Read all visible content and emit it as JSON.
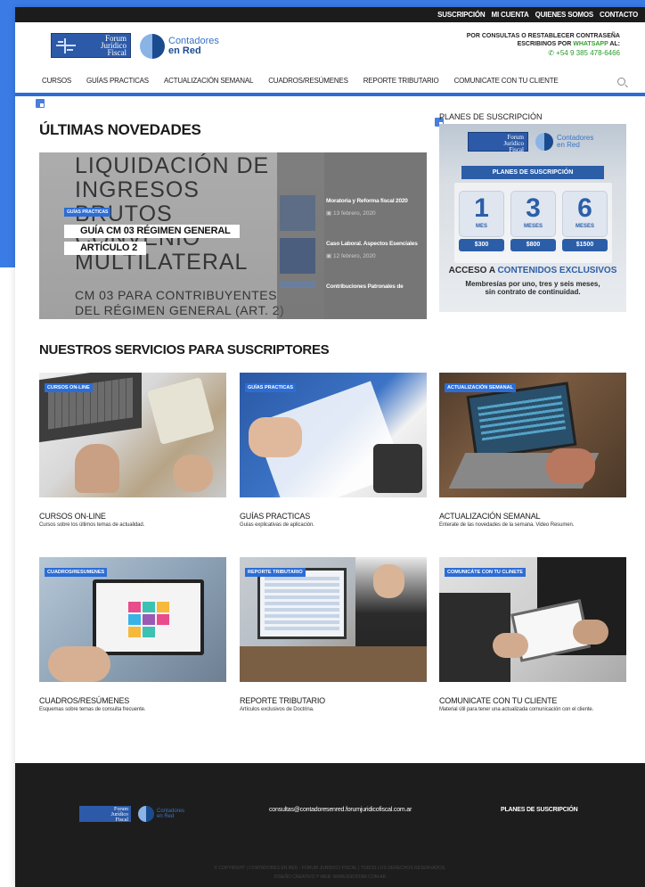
{
  "topbar": {
    "links": [
      "SUSCRIPCIÓN",
      "MI CUENTA",
      "QUIENES SOMOS",
      "CONTACTO"
    ]
  },
  "header": {
    "logo_forum": [
      "Forum",
      "Jurídico",
      "Fiscal"
    ],
    "logo_contadores": [
      "Contadores",
      "en Red"
    ],
    "contact_line1": "POR CONSULTAS O RESTABLECER CONTRASEÑA",
    "contact_line2_prefix": "ESCRIBINOS POR ",
    "contact_whatsapp": "WHATSAPP",
    "contact_line2_suffix": " AL:",
    "contact_phone": "+54 9 385 478-6466"
  },
  "nav": {
    "items": [
      "CURSOS",
      "GUÍAS PRACTICAS",
      "ACTUALIZACIÓN SEMANAL",
      "CUADROS/RESÚMENES",
      "REPORTE TRIBUTARIO",
      "COMUNICATE CON TU CLIENTE"
    ]
  },
  "latest": {
    "heading": "ÚLTIMAS NOVEDADES",
    "hero_image_text": [
      "LIQUIDACIÓN DE",
      "INGRESOS",
      "BRUTOS",
      "CONVENIO",
      "MULTILATERAL"
    ],
    "hero_image_small": [
      "CM 03 PARA CONTRIBUYENTES",
      "DEL RÉGIMEN GENERAL (ART. 2)"
    ],
    "hero_badge": "GUÍAS PRACTICAS",
    "hero_title": "GUÍA CM 03 RÉGIMEN GENERAL ARTÍCULO 2",
    "side": [
      {
        "title": "Moratoria y Reforma fiscal 2020",
        "date": "13 febrero, 2020"
      },
      {
        "title": "Caso Laboral. Aspectos Esenciales",
        "date": "12 febrero, 2020"
      },
      {
        "title": "Contribuciones Patronales de",
        "date": ""
      }
    ]
  },
  "plans": {
    "title": "PLANES DE SUSCRIPCIÓN",
    "card_header": "PLANES DE SUSCRIPCIÓN",
    "logo_forum": [
      "Forum",
      "Jurídico",
      "Fiscal"
    ],
    "logo_contadores": [
      "Contadores",
      "en Red"
    ],
    "options": [
      {
        "number": "1",
        "unit": "MES",
        "price": "$300"
      },
      {
        "number": "3",
        "unit": "MESES",
        "price": "$800"
      },
      {
        "number": "6",
        "unit": "MESES",
        "price": "$1500"
      }
    ],
    "acceso_prefix": "ACCESO A ",
    "acceso_highlight": "CONTENIDOS EXCLUSIVOS",
    "desc_line1": "Membresías por uno, tres y seis meses,",
    "desc_line2": "sin contrato de continuidad."
  },
  "services": {
    "heading": "NUESTROS SERVICIOS PARA SUSCRIPTORES",
    "items": [
      {
        "badge": "CURSOS ON-LINE",
        "title": "CURSOS ON-LINE",
        "desc": "Cursos sobre los últimos temas de actualidad."
      },
      {
        "badge": "GUÍAS PRACTICAS",
        "title": "GUÍAS PRACTICAS",
        "desc": "Guías explicativas de aplicación."
      },
      {
        "badge": "ACTUALIZACIÓN SEMANAL",
        "title": "ACTUALIZACIÓN SEMANAL",
        "desc": "Enterate de las novedades de la semana. Video Resumen."
      },
      {
        "badge": "CUADROS/RESUMENES",
        "title": "CUADROS/RESÚMENES",
        "desc": "Esquemas sobre temas de consulta frecuente."
      },
      {
        "badge": "REPORTE TRIBUTARIO",
        "title": "REPORTE TRIBUTARIO",
        "desc": "Artículos exclusivos de Doctrina."
      },
      {
        "badge": "COMUNICÁTE CON TU CLINETE",
        "title": "COMUNICATE CON TU CLIENTE",
        "desc": "Material útil para tener una actualizada comunicación con el cliente."
      }
    ]
  },
  "footer": {
    "email": "consultas@contadoresenred.forumjuridicofiscal.com.ar",
    "plans_link": "PLANES DE SUSCRIPCIÓN",
    "logo_forum": [
      "Forum",
      "Jurídico",
      "Fiscal"
    ],
    "logo_contadores": [
      "Contadores",
      "en Red"
    ],
    "copyright_line1": "© COPYRIGHT | CONTADORES EN RED - FORUM JURIDICO FISCAL | TODOS LOS DERECHOS RESERVADOS.",
    "copyright_line2": "DISEÑO CREATIVO Y WEB: WWW.IDIDSTAR.COM.AR"
  },
  "colors": {
    "accent": "#2c6dd5",
    "background_outer": "#3b7be6",
    "footer": "#1d1d1d",
    "whatsapp": "#33a02c"
  }
}
